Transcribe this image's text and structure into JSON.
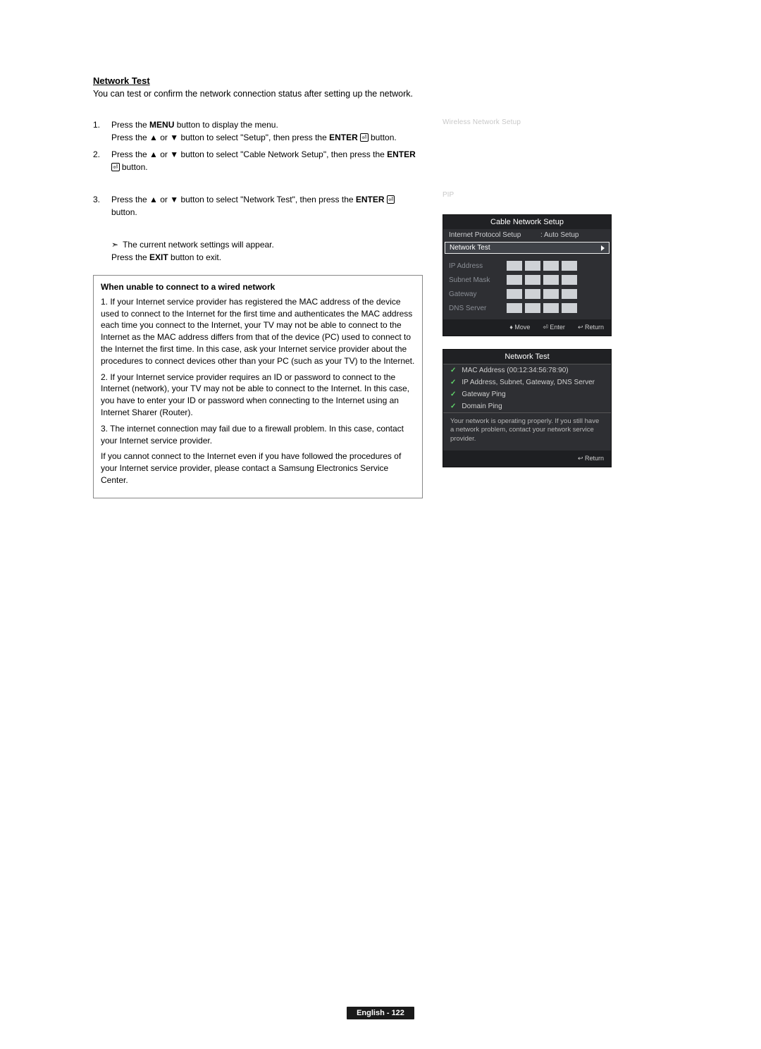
{
  "section_title": "Network Test",
  "intro": "You can test or confirm the network connection status after setting up the network.",
  "steps_block1": [
    {
      "num": "1.",
      "lines": [
        {
          "pre": "Press the ",
          "bold": "MENU",
          "post": " button to display the menu."
        },
        {
          "pre": "Press the ▲ or ▼ button to select \"Setup\", then press the ",
          "bold": "ENTER",
          "glyph": true,
          "post": " button."
        }
      ]
    },
    {
      "num": "2.",
      "lines": [
        {
          "pre": "Press the ▲ or ▼ button to select \"Cable Network Setup\", then press the ",
          "bold": "ENTER",
          "glyph": true,
          "post": " button."
        }
      ]
    }
  ],
  "steps_block2": [
    {
      "num": "3.",
      "lines": [
        {
          "pre": "Press the ▲ or ▼ button to select \"Network Test\", then press the ",
          "bold": "ENTER",
          "glyph": true,
          "post": " button."
        }
      ]
    }
  ],
  "subnote_arrow": "➣",
  "subnote_text": "The current network settings will appear.",
  "subnote_exit_pre": "Press the ",
  "subnote_exit_bold": "EXIT",
  "subnote_exit_post": " button to exit.",
  "box_title": "When unable to connect to a wired network",
  "box_items": [
    "1. If your Internet service provider has registered the MAC address of the device used to connect to the Internet for the first time and authenticates the MAC address each time you connect to the Internet, your TV may not be able to connect to the Internet as the MAC address differs from that of the device (PC) used to connect to the Internet the first time. In this case, ask your Internet service provider about the procedures to connect devices other than your PC (such as your TV) to the Internet.",
    "2. If your Internet service provider requires an ID or password to connect to the Internet (network), your TV may not be able to connect to the Internet. In this case, you have to enter your ID or password when connecting to the Internet using an Internet Sharer (Router).",
    "3. The internet connection may fail due to a firewall problem. In this case, contact your Internet service provider."
  ],
  "box_tail": "If you cannot connect to the Internet even if you have followed the procedures of your Internet service provider, please contact a Samsung Electronics Service Center.",
  "right": {
    "wireless_label": "Wireless Network Setup",
    "pip": "PIP",
    "osd1": {
      "title": "Cable Network Setup",
      "proto_key": "Internet Protocol Setup",
      "proto_val": ": Auto Setup",
      "highlight": "Network Test",
      "ip_rows": [
        "IP Address",
        "Subnet Mask",
        "Gateway",
        "DNS Server"
      ],
      "footer_move": "Move",
      "footer_enter": "Enter",
      "footer_return": "Return"
    },
    "osd2": {
      "title": "Network Test",
      "checks": [
        "MAC Address (00:12:34:56:78:90)",
        "IP Address, Subnet, Gateway, DNS Server",
        "Gateway Ping",
        "Domain Ping"
      ],
      "msg": "Your network is operating properly. If you still have a network problem, contact your network service provider.",
      "footer_return": "Return"
    }
  },
  "footer_label": "English - 122"
}
